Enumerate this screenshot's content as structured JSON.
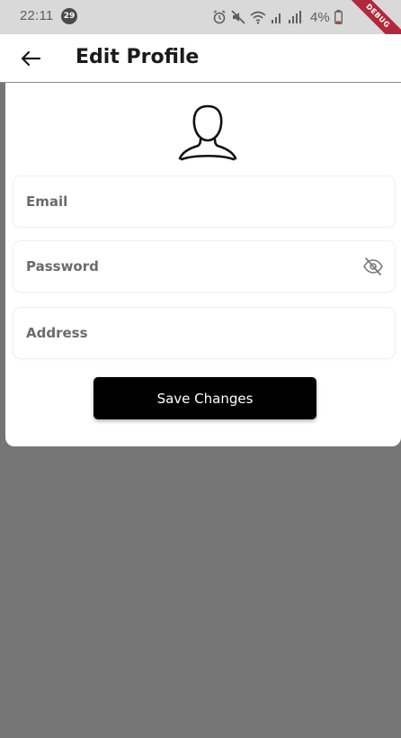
{
  "status_bar": {
    "time": "22:11",
    "notification_count": "29",
    "battery": "4%"
  },
  "debug_banner": "DEBUG",
  "app_bar": {
    "title": "Edit Profile",
    "back_icon": "arrow-left-icon"
  },
  "profile": {
    "avatar_icon": "user-outline-icon"
  },
  "form": {
    "email": {
      "placeholder": "Email",
      "value": ""
    },
    "password": {
      "placeholder": "Password",
      "value": "",
      "toggle_icon": "eye-off-icon"
    },
    "address": {
      "placeholder": "Address",
      "value": ""
    },
    "save_label": "Save Changes"
  },
  "colors": {
    "status_bar_bg": "#d9d9d9",
    "scrim": "#757575",
    "button_bg": "#000000",
    "button_text": "#ffffff",
    "debug_ribbon": "#b0283a"
  }
}
